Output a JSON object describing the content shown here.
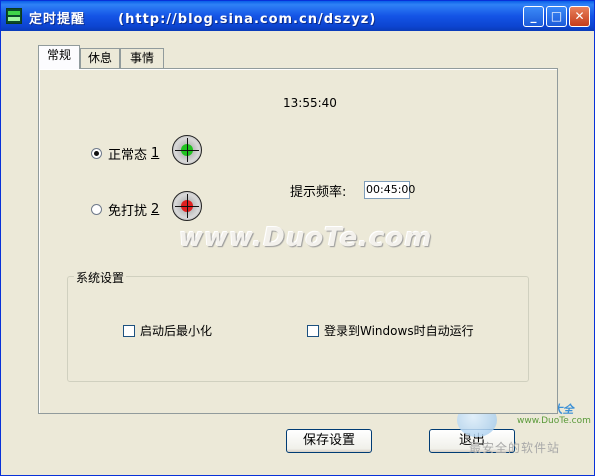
{
  "window": {
    "title": "定时提醒      (http://blog.sina.com.cn/dszyz)",
    "controls": {
      "minimize": "_",
      "maximize": "□",
      "close": "✕"
    }
  },
  "tabs": [
    {
      "label": "常规",
      "active": true
    },
    {
      "label": "休息",
      "active": false
    },
    {
      "label": "事情",
      "active": false
    }
  ],
  "general": {
    "clock": "13:55:40",
    "modes": [
      {
        "label": "正常态",
        "key": "1",
        "checked": true,
        "indicator_color": "#1fc21f"
      },
      {
        "label": "免打扰",
        "key": "2",
        "checked": false,
        "indicator_color": "#e02020"
      }
    ],
    "frequency_label": "提示频率:",
    "frequency_value": "00:45:00",
    "watermark": "www.DuoTe.com"
  },
  "system_settings": {
    "title": "系统设置",
    "options": [
      {
        "label": "启动后最小化",
        "checked": false
      },
      {
        "label": "登录到Windows时自动运行",
        "checked": false
      }
    ]
  },
  "buttons": {
    "save": "保存设置",
    "exit": "退出"
  },
  "corner_logo": {
    "brand": "2345软件大全",
    "url": "www.DuoTe.com",
    "slogan": "最安全的软件站"
  }
}
